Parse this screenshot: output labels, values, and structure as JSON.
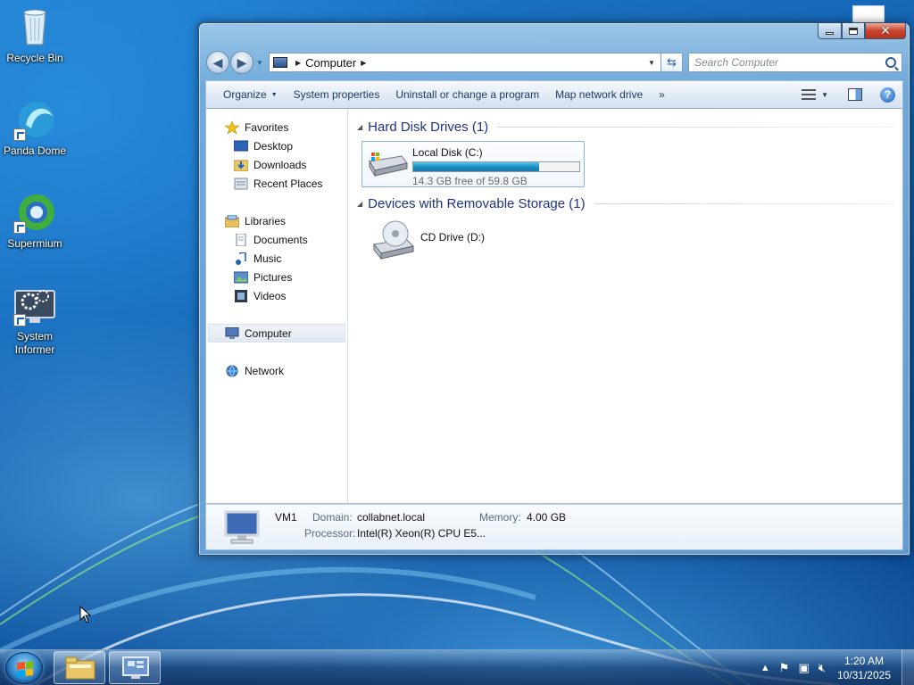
{
  "desktop": {
    "icons": [
      {
        "label": "Recycle Bin"
      },
      {
        "label": "Panda Dome"
      },
      {
        "label": "Supermium"
      },
      {
        "label": "System Informer"
      }
    ]
  },
  "window": {
    "address": {
      "crumb": "Computer"
    },
    "search": {
      "placeholder": "Search Computer"
    },
    "toolbar": {
      "organize": "Organize",
      "system_properties": "System properties",
      "uninstall": "Uninstall or change a program",
      "map_drive": "Map network drive",
      "more": "»"
    },
    "nav": {
      "favorites": "Favorites",
      "desktop": "Desktop",
      "downloads": "Downloads",
      "recent_places": "Recent Places",
      "libraries": "Libraries",
      "documents": "Documents",
      "music": "Music",
      "pictures": "Pictures",
      "videos": "Videos",
      "computer": "Computer",
      "network": "Network"
    },
    "groups": {
      "hdd_header": "Hard Disk Drives (1)",
      "removable_header": "Devices with Removable Storage (1)"
    },
    "drives": {
      "local_name": "Local Disk (C:)",
      "local_free": "14.3 GB free of 59.8 GB",
      "local_used_fraction": 0.76,
      "cd_name": "CD Drive (D:)"
    },
    "details": {
      "name": "VM1",
      "domain_label": "Domain:",
      "domain_value": "collabnet.local",
      "memory_label": "Memory:",
      "memory_value": "4.00 GB",
      "processor_label": "Processor:",
      "processor_value": "Intel(R) Xeon(R) CPU E5..."
    }
  },
  "taskbar": {
    "time": "1:20 AM",
    "date": "10/31/2025"
  },
  "colors": {
    "accent": "#1e3287",
    "progress": "#1c8fc4"
  }
}
